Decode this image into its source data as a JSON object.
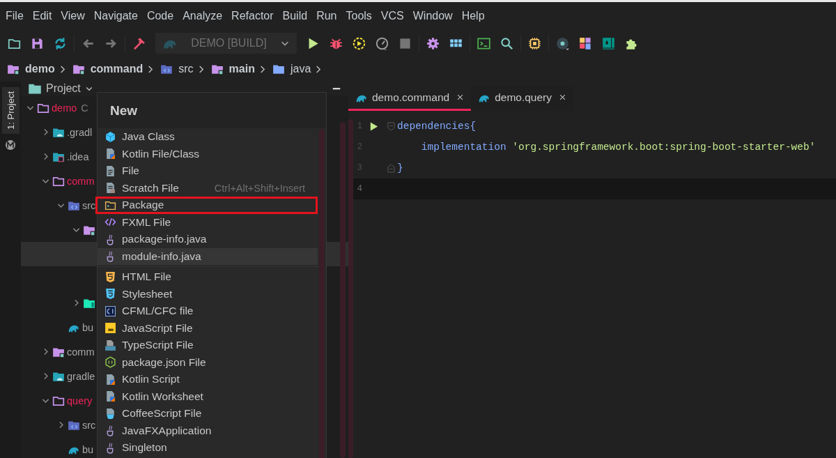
{
  "menu_bar": [
    "File",
    "Edit",
    "View",
    "Navigate",
    "Code",
    "Analyze",
    "Refactor",
    "Build",
    "Run",
    "Tools",
    "VCS",
    "Window",
    "Help"
  ],
  "toolbar": {
    "run_configuration": "DEMO [BUILD]"
  },
  "breadcrumbs": [
    {
      "label": "demo",
      "kind": "module"
    },
    {
      "label": "command",
      "kind": "module"
    },
    {
      "label": "src",
      "kind": "source"
    },
    {
      "label": "main",
      "kind": "module"
    },
    {
      "label": "java",
      "kind": "folder"
    }
  ],
  "side_tabs": [
    {
      "label": "1: Project",
      "selected": true
    }
  ],
  "project": {
    "title": "Project",
    "tree": [
      {
        "name": "demo",
        "hint": "C",
        "kind": "module-root",
        "expanded": true,
        "selected": false,
        "color": "#f0245a",
        "children": [
          {
            "name": ".gradl",
            "kind": "gradle",
            "expanded": false,
            "selected": false
          },
          {
            "name": ".idea",
            "kind": "idea",
            "expanded": false,
            "selected": false
          },
          {
            "name": "comm",
            "kind": "module-root",
            "expanded": true,
            "selected": false,
            "color": "#f0245a",
            "children": [
              {
                "name": "src",
                "kind": "source",
                "expanded": true,
                "selected": false,
                "children": [
                  {
                    "kind": "module",
                    "expanded": true,
                    "selected": false,
                    "children": [
                      {
                        "selected": true
                      },
                      {
                        "selected": false
                      }
                    ]
                  },
                  {
                    "kind": "test",
                    "expanded": false,
                    "selected": false
                  }
                ]
              },
              {
                "name": "bu",
                "kind": "build-file",
                "selected": false
              }
            ]
          },
          {
            "name": "comm",
            "kind": "module",
            "expanded": false,
            "selected": false
          },
          {
            "name": "gradle",
            "kind": "gradle",
            "expanded": false,
            "selected": false
          },
          {
            "name": "query",
            "kind": "module-root",
            "expanded": true,
            "selected": false,
            "color": "#f0245a",
            "children": [
              {
                "name": "src",
                "kind": "source",
                "expanded": false,
                "selected": false
              },
              {
                "name": "bu",
                "kind": "build-file",
                "selected": false
              }
            ]
          }
        ]
      }
    ]
  },
  "editor": {
    "tabs": [
      {
        "label": "demo.command",
        "selected": true
      },
      {
        "label": "demo.query",
        "selected": false
      }
    ],
    "lines": [
      {
        "number": "1",
        "run_marker": true,
        "fold_start": true,
        "current": false,
        "tokens": [
          {
            "text": "dependencies{",
            "kind": "keyword"
          }
        ]
      },
      {
        "number": "2",
        "current": false,
        "tokens": [
          {
            "text": "    implementation ",
            "kind": "method"
          },
          {
            "text": "'org.springframework.boot:spring-boot-starter-web'",
            "kind": "string"
          }
        ]
      },
      {
        "number": "3",
        "fold_end": true,
        "current": false,
        "tokens": [
          {
            "text": "}",
            "kind": "keyword"
          }
        ]
      },
      {
        "number": "4",
        "current": true
      }
    ]
  },
  "popup": {
    "title": "New",
    "groups": [
      [
        {
          "label": "Java Class",
          "kind": "java-class",
          "selected": false
        },
        {
          "label": "Kotlin File/Class",
          "kind": "kotlin",
          "selected": false
        },
        {
          "label": "File",
          "kind": "file",
          "selected": false
        },
        {
          "label": "Scratch File",
          "kind": "scratch",
          "shortcut": "Ctrl+Alt+Shift+Insert",
          "selected": false
        },
        {
          "label": "Package",
          "kind": "package",
          "selected": false,
          "annotated": true
        },
        {
          "label": "FXML File",
          "kind": "fxml",
          "selected": false
        },
        {
          "label": "package-info.java",
          "kind": "java",
          "selected": false
        },
        {
          "label": "module-info.java",
          "kind": "java",
          "selected": true
        }
      ],
      [
        {
          "label": "HTML File",
          "kind": "html",
          "selected": false
        },
        {
          "label": "Stylesheet",
          "kind": "css",
          "selected": false
        },
        {
          "label": "CFML/CFC file",
          "kind": "cfml",
          "selected": false
        },
        {
          "label": "JavaScript File",
          "kind": "js",
          "selected": false
        },
        {
          "label": "TypeScript File",
          "kind": "ts",
          "selected": false
        },
        {
          "label": "package.json File",
          "kind": "npm",
          "selected": false
        },
        {
          "label": "Kotlin Script",
          "kind": "kotlin",
          "selected": false
        },
        {
          "label": "Kotlin Worksheet",
          "kind": "kotlin",
          "selected": false
        },
        {
          "label": "CoffeeScript File",
          "kind": "coffee",
          "selected": false
        },
        {
          "label": "JavaFXApplication",
          "kind": "java",
          "selected": false
        },
        {
          "label": "Singleton",
          "kind": "java",
          "selected": false
        }
      ]
    ]
  }
}
